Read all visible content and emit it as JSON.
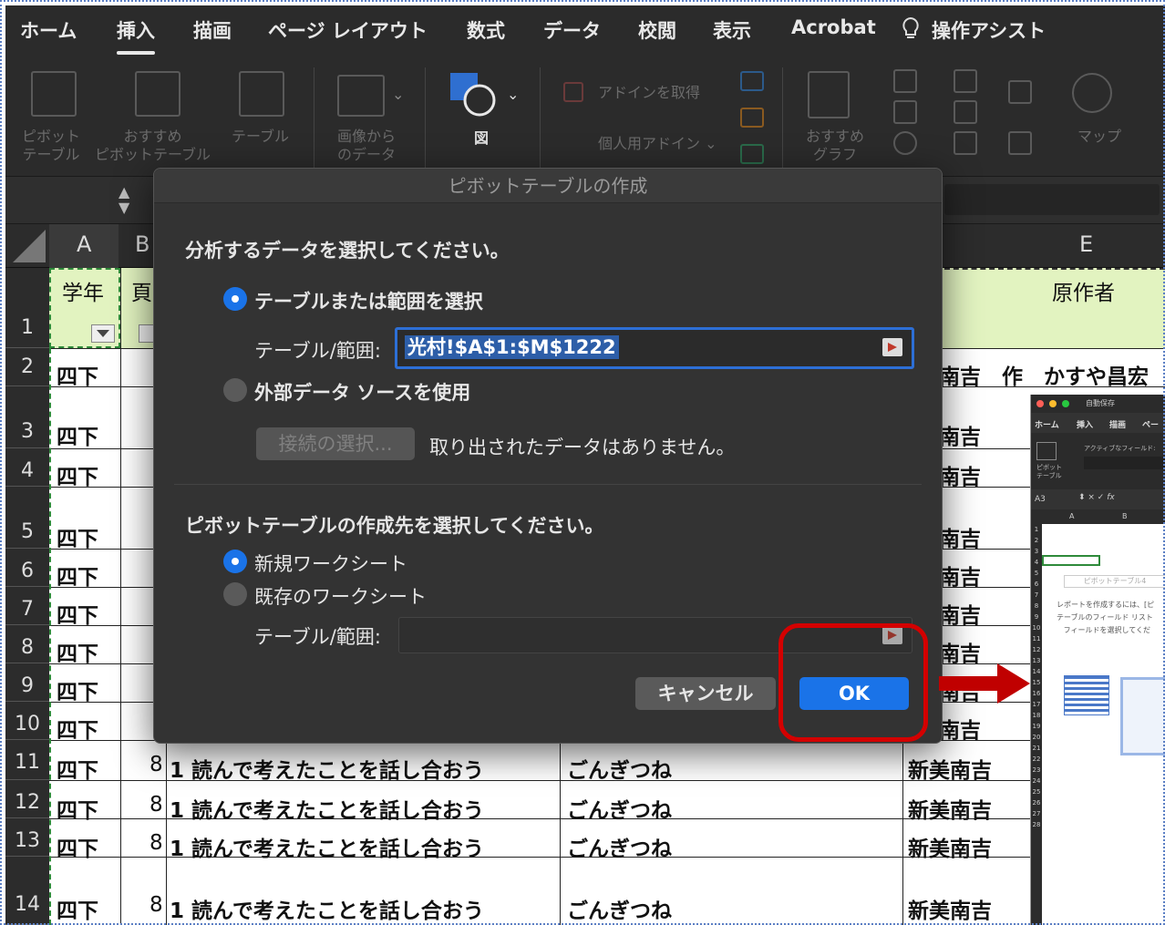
{
  "ribbon_tabs": [
    "ホーム",
    "挿入",
    "描画",
    "ページ レイアウト",
    "数式",
    "データ",
    "校閲",
    "表示",
    "Acrobat",
    "操作アシスト"
  ],
  "active_tab": "挿入",
  "ribbon": {
    "pivot_l1": "ピボット",
    "pivot_l2": "テーブル",
    "rec_pivot_l1": "おすすめ",
    "rec_pivot_l2": "ピボットテーブル",
    "table": "テーブル",
    "img_data_l1": "画像から",
    "img_data_l2": "のデータ",
    "figure": "図",
    "get_addins": "アドインを取得",
    "personal_addins": "個人用アドイン",
    "rec_chart_l1": "おすすめ",
    "rec_chart_l2": "グラフ",
    "map": "マップ"
  },
  "columns": {
    "a": "A",
    "b": "B",
    "e": "E"
  },
  "header_row": {
    "a": "学年",
    "b": "頁",
    "e": "原作者"
  },
  "row_numbers": [
    "1",
    "2",
    "3",
    "4",
    "5",
    "6",
    "7",
    "8",
    "9",
    "10",
    "11",
    "12",
    "13",
    "14"
  ],
  "cells": {
    "grade": "四下",
    "page": "8",
    "lesson": "1 読んで考えたことを話し合おう",
    "title": "ごんぎつね",
    "author_partial": "新美南吉",
    "row2_e": "南吉　作　かすや昌宏",
    "e_partial": "南吉"
  },
  "dialog": {
    "title": "ピボットテーブルの作成",
    "section1": "分析するデータを選択してください。",
    "opt_table": "テーブルまたは範囲を選択",
    "range_label": "テーブル/範囲:",
    "range_value": "光村!$A$1:$M$1222",
    "opt_external": "外部データ ソースを使用",
    "connect_btn": "接続の選択...",
    "no_data": "取り出されたデータはありません。",
    "section2": "ピボットテーブルの作成先を選択してください。",
    "opt_new": "新規ワークシート",
    "opt_existing": "既存のワークシート",
    "range_label2": "テーブル/範囲:",
    "cancel": "キャンセル",
    "ok": "OK"
  },
  "inset": {
    "autosave": "自動保存",
    "tab1": "ホーム",
    "tab2": "挿入",
    "tab3": "描画",
    "tab4": "ペー",
    "active_field": "アクティブなフィールド:",
    "pivot": "ピボット",
    "table": "テーブル",
    "cellref": "A3",
    "pivot_name": "ピボットテーブル4",
    "help1": "レポートを作成するには、[ピ",
    "help2": "テーブルのフィールド リスト",
    "help3": "フィールドを選択してくだ"
  },
  "colors": {
    "accent": "#1a73e8",
    "highlight": "#d40000",
    "header_fill": "#e2f3c0"
  }
}
